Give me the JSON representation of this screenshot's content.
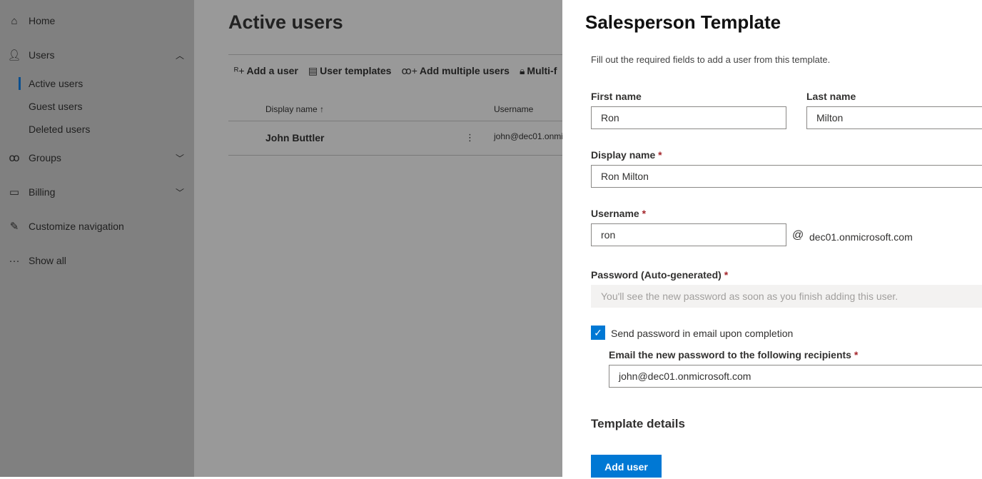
{
  "sidebar": {
    "home": "Home",
    "users": "Users",
    "active_users": "Active users",
    "guest_users": "Guest users",
    "deleted_users": "Deleted users",
    "groups": "Groups",
    "billing": "Billing",
    "customize": "Customize navigation",
    "show_all": "Show all"
  },
  "main": {
    "title": "Active users",
    "toolbar": {
      "add_user": "Add a user",
      "templates": "User templates",
      "add_multiple": "Add multiple users",
      "mfa": "Multi-f"
    },
    "columns": {
      "display_name": "Display name ↑",
      "username": "Username"
    },
    "rows": [
      {
        "display_name": "John Buttler",
        "username": "john@dec01.onmi"
      }
    ]
  },
  "panel": {
    "title": "Salesperson Template",
    "intro": "Fill out the required fields to add a user from this template.",
    "first_name_label": "First name",
    "first_name": "Ron",
    "last_name_label": "Last name",
    "last_name": "Milton",
    "display_name_label": "Display name",
    "display_name": "Ron Milton",
    "username_label": "Username",
    "username": "ron",
    "domain": "dec01.onmicrosoft.com",
    "password_label": "Password (Auto-generated)",
    "password_placeholder": "You'll see the new password as soon as you finish adding this user.",
    "send_label": "Send password in email upon completion",
    "send_checked": true,
    "recipients_label": "Email the new password to the following recipients",
    "recipients": "john@dec01.onmicrosoft.com",
    "template_details": "Template details",
    "add_user": "Add user",
    "required_mark": "*",
    "at": "@"
  },
  "colors": {
    "accent": "#0078d4",
    "required": "#a4262c"
  }
}
